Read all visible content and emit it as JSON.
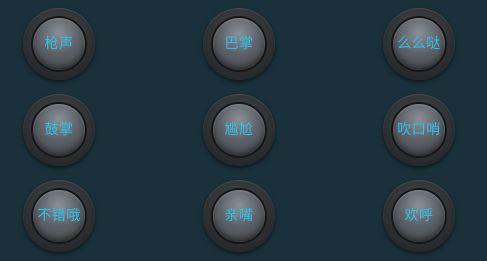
{
  "buttons": [
    {
      "label": "枪声"
    },
    {
      "label": "巴掌"
    },
    {
      "label": "么么哒"
    },
    {
      "label": "鼓掌"
    },
    {
      "label": "尴尬"
    },
    {
      "label": "吹口哨"
    },
    {
      "label": "不错哦"
    },
    {
      "label": "亲嘴"
    },
    {
      "label": "欢呼"
    }
  ],
  "colors": {
    "background": "#1a313b",
    "label": "#2ec3ea"
  }
}
